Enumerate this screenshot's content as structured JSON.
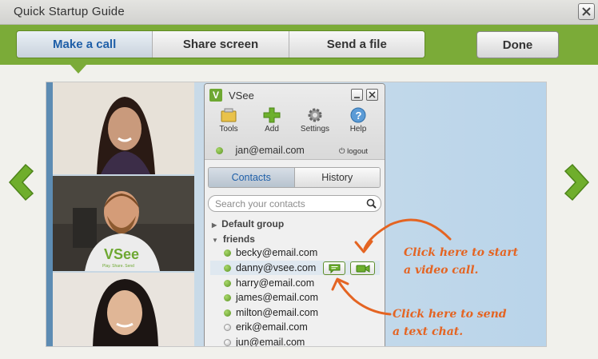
{
  "window": {
    "title": "Quick Startup Guide"
  },
  "tabs": [
    {
      "label": "Make a call",
      "active": true
    },
    {
      "label": "Share screen",
      "active": false
    },
    {
      "label": "Send a file",
      "active": false
    }
  ],
  "done_label": "Done",
  "colors": {
    "accent_green": "#7bab38",
    "active_tab_text": "#1f5fa8",
    "annotation": "#e46422"
  },
  "vsee": {
    "title": "VSee",
    "logo_letter": "V",
    "tools": [
      {
        "label": "Tools",
        "icon": "tools-icon"
      },
      {
        "label": "Add",
        "icon": "add-icon"
      },
      {
        "label": "Settings",
        "icon": "gear-icon"
      },
      {
        "label": "Help",
        "icon": "help-icon"
      }
    ],
    "user_email": "jan@email.com",
    "logout_label": "logout",
    "contact_tabs": [
      {
        "label": "Contacts",
        "active": true
      },
      {
        "label": "History",
        "active": false
      }
    ],
    "search_placeholder": "Search your contacts",
    "groups": [
      {
        "label": "Default group",
        "expanded": false
      },
      {
        "label": "friends",
        "expanded": true
      }
    ],
    "contacts": [
      {
        "email": "becky@email.com",
        "online": true
      },
      {
        "email": "danny@vsee.com",
        "online": true,
        "selected": true
      },
      {
        "email": "harry@email.com",
        "online": true
      },
      {
        "email": "james@email.com",
        "online": true
      },
      {
        "email": "milton@email.com",
        "online": true
      },
      {
        "email": "erik@email.com",
        "online": false
      },
      {
        "email": "jun@email.com",
        "online": false
      }
    ]
  },
  "annotations": {
    "video_line1": "Click here to start",
    "video_line2": "a video call.",
    "chat_line1": "Click here to send",
    "chat_line2": "a text chat."
  },
  "video_tiles": [
    {
      "caption": ""
    },
    {
      "shirt_text": "VSee",
      "shirt_subtext": "Play. Share. Send"
    },
    {
      "caption": ""
    }
  ]
}
